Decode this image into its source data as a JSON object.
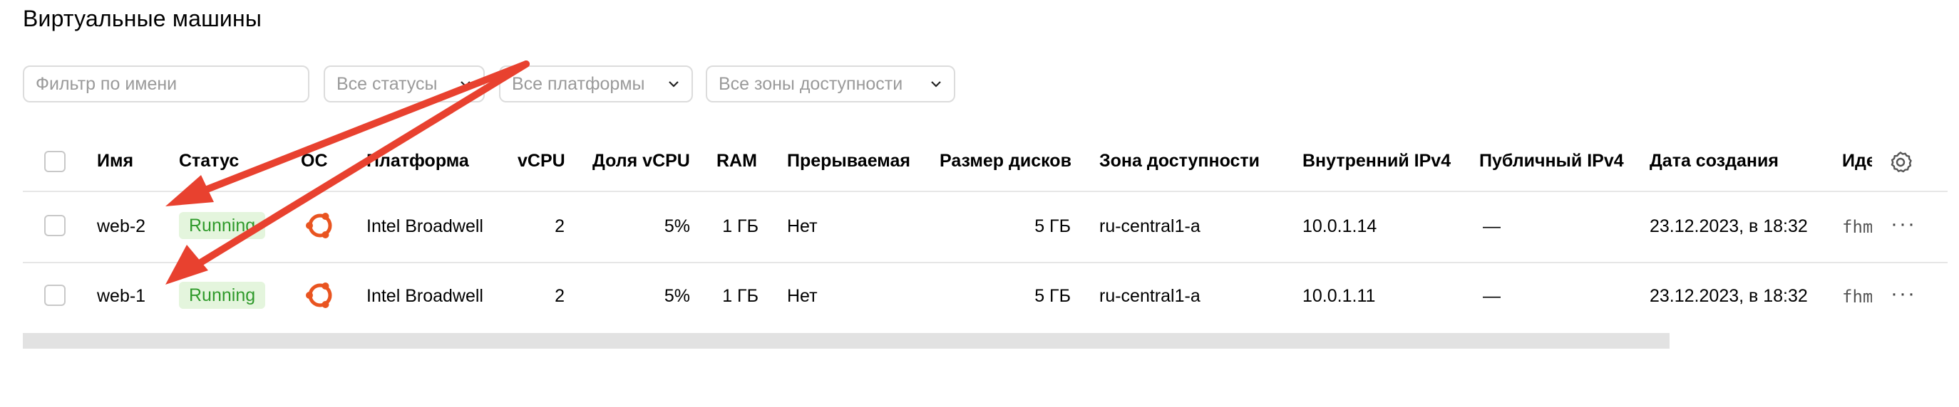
{
  "page": {
    "title": "Виртуальные машины"
  },
  "filters": {
    "name_placeholder": "Фильтр по имени",
    "status": "Все статусы",
    "platform": "Все платформы",
    "zone": "Все зоны доступности"
  },
  "table": {
    "columns": [
      "Имя",
      "Статус",
      "ОС",
      "Платформа",
      "vCPU",
      "Доля vCPU",
      "RAM",
      "Прерываемая",
      "Размер дисков",
      "Зона доступности",
      "Внутренний IPv4",
      "Публичный IPv4",
      "Дата создания",
      "Иде"
    ],
    "rows": [
      {
        "name": "web-2",
        "status": "Running",
        "os_icon": "ubuntu-icon",
        "platform": "Intel Broadwell",
        "vcpu": "2",
        "vcpu_share": "5%",
        "ram": "1 ГБ",
        "preemptible": "Нет",
        "disk_size": "5 ГБ",
        "zone": "ru-central1-a",
        "internal_ipv4": "10.0.1.14",
        "public_ipv4": "—",
        "created": "23.12.2023, в 18:32",
        "id": "fhm"
      },
      {
        "name": "web-1",
        "status": "Running",
        "os_icon": "ubuntu-icon",
        "platform": "Intel Broadwell",
        "vcpu": "2",
        "vcpu_share": "5%",
        "ram": "1 ГБ",
        "preemptible": "Нет",
        "disk_size": "5 ГБ",
        "zone": "ru-central1-a",
        "internal_ipv4": "10.0.1.11",
        "public_ipv4": "—",
        "created": "23.12.2023, в 18:32",
        "id": "fhm"
      }
    ],
    "more_label": "···"
  },
  "colors": {
    "status_running_bg": "#e4f5dd",
    "status_running_text": "#2f9a2b",
    "ubuntu": "#e95420",
    "annotation_arrow": "#e8412f"
  },
  "icons": {
    "settings": "gear-icon",
    "row_menu": "more-icon",
    "dropdown": "chevron-down-icon"
  }
}
